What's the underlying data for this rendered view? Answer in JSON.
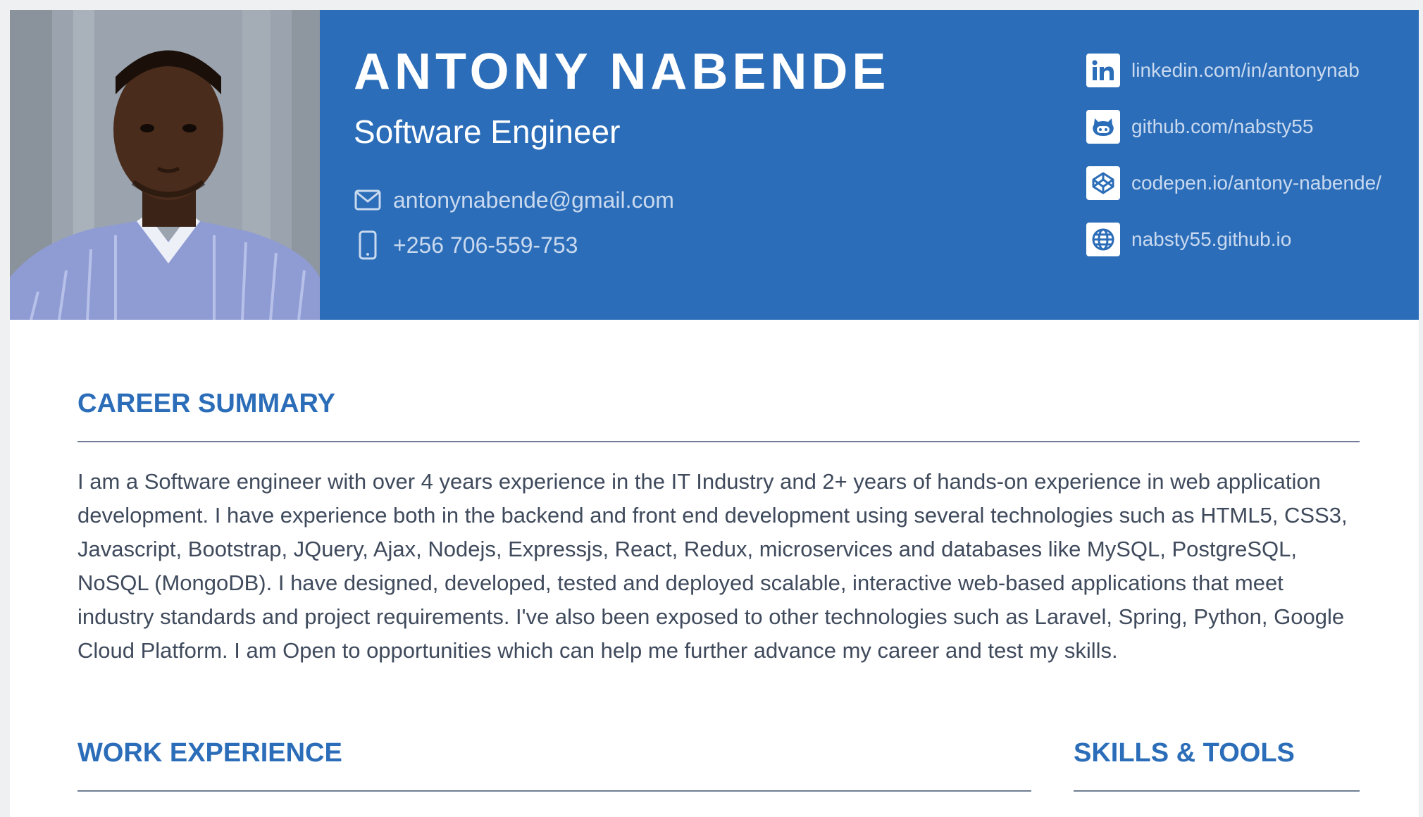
{
  "profile": {
    "name": "ANTONY NABENDE",
    "title": "Software Engineer",
    "email": "antonynabende@gmail.com",
    "phone": "+256 706-559-753"
  },
  "links": [
    {
      "icon": "linkedin-icon",
      "label": "linkedin.com/in/antonynab"
    },
    {
      "icon": "github-icon",
      "label": "github.com/nabsty55"
    },
    {
      "icon": "codepen-icon",
      "label": "codepen.io/antony-nabende/"
    },
    {
      "icon": "globe-icon",
      "label": "nabsty55.github.io"
    }
  ],
  "sections": {
    "career_summary": {
      "title": "CAREER SUMMARY",
      "text": "I am a Software engineer with over 4 years experience in the IT Industry and 2+ years of hands-on experience in web application development. I have experience both in the backend and front end development using several technologies such as HTML5, CSS3, Javascript, Bootstrap, JQuery, Ajax, Nodejs, Expressjs, React, Redux, microservices and databases like MySQL, PostgreSQL, NoSQL (MongoDB). I have designed, developed, tested and deployed scalable, interactive web-based applications that meet industry standards and project requirements. I've also been exposed to other technologies such as Laravel, Spring, Python, Google Cloud Platform. I am Open to opportunities which can help me further advance my career and test my skills."
    },
    "work_experience": {
      "title": "WORK EXPERIENCE"
    },
    "skills_tools": {
      "title": "SKILLS & TOOLS"
    }
  },
  "colors": {
    "header_bg": "#2b6db8",
    "accent": "#2b6db8",
    "body_text": "#3f4a5c",
    "link_text": "#c9d9ef"
  }
}
